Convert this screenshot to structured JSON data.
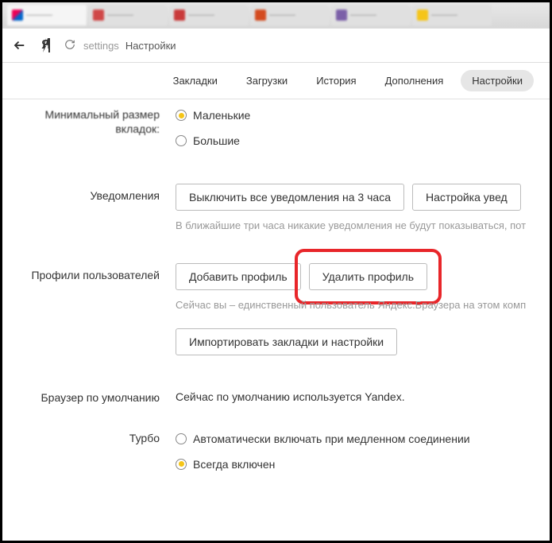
{
  "tabs": [
    {
      "label": "",
      "fav": "#e05a5a"
    },
    {
      "label": "",
      "fav": "#d04848"
    },
    {
      "label": "",
      "fav": "#c93a3a"
    },
    {
      "label": "",
      "fav": "#d44b1f"
    },
    {
      "label": "",
      "fav": "#7b5fa8"
    },
    {
      "label": "",
      "fav": "#f5c518"
    }
  ],
  "address": {
    "prefix": "settings",
    "title": "Настройки"
  },
  "nav": {
    "items": [
      "Закладки",
      "Загрузки",
      "История",
      "Дополнения",
      "Настройки"
    ],
    "active": 4
  },
  "tab_size": {
    "label": "Минимальный размер вкладок:",
    "options": [
      "Маленькие",
      "Большие"
    ],
    "selected": 0
  },
  "notifications": {
    "label": "Уведомления",
    "disable_btn": "Выключить все уведомления на 3 часа",
    "settings_btn": "Настройка увед",
    "hint": "В ближайшие три часа никакие уведомления не будут показываться, пот"
  },
  "profiles": {
    "label": "Профили пользователей",
    "add_btn": "Добавить профиль",
    "delete_btn": "Удалить профиль",
    "hint": "Сейчас вы – единственный пользователь Яндекс.Браузера на этом комп",
    "import_btn": "Импортировать закладки и настройки"
  },
  "default_browser": {
    "label": "Браузер по умолчанию",
    "text": "Сейчас по умолчанию используется Yandex."
  },
  "turbo": {
    "label": "Турбо",
    "options": [
      "Автоматически включать при медленном соединении",
      "Всегда включен"
    ],
    "selected": 1
  }
}
